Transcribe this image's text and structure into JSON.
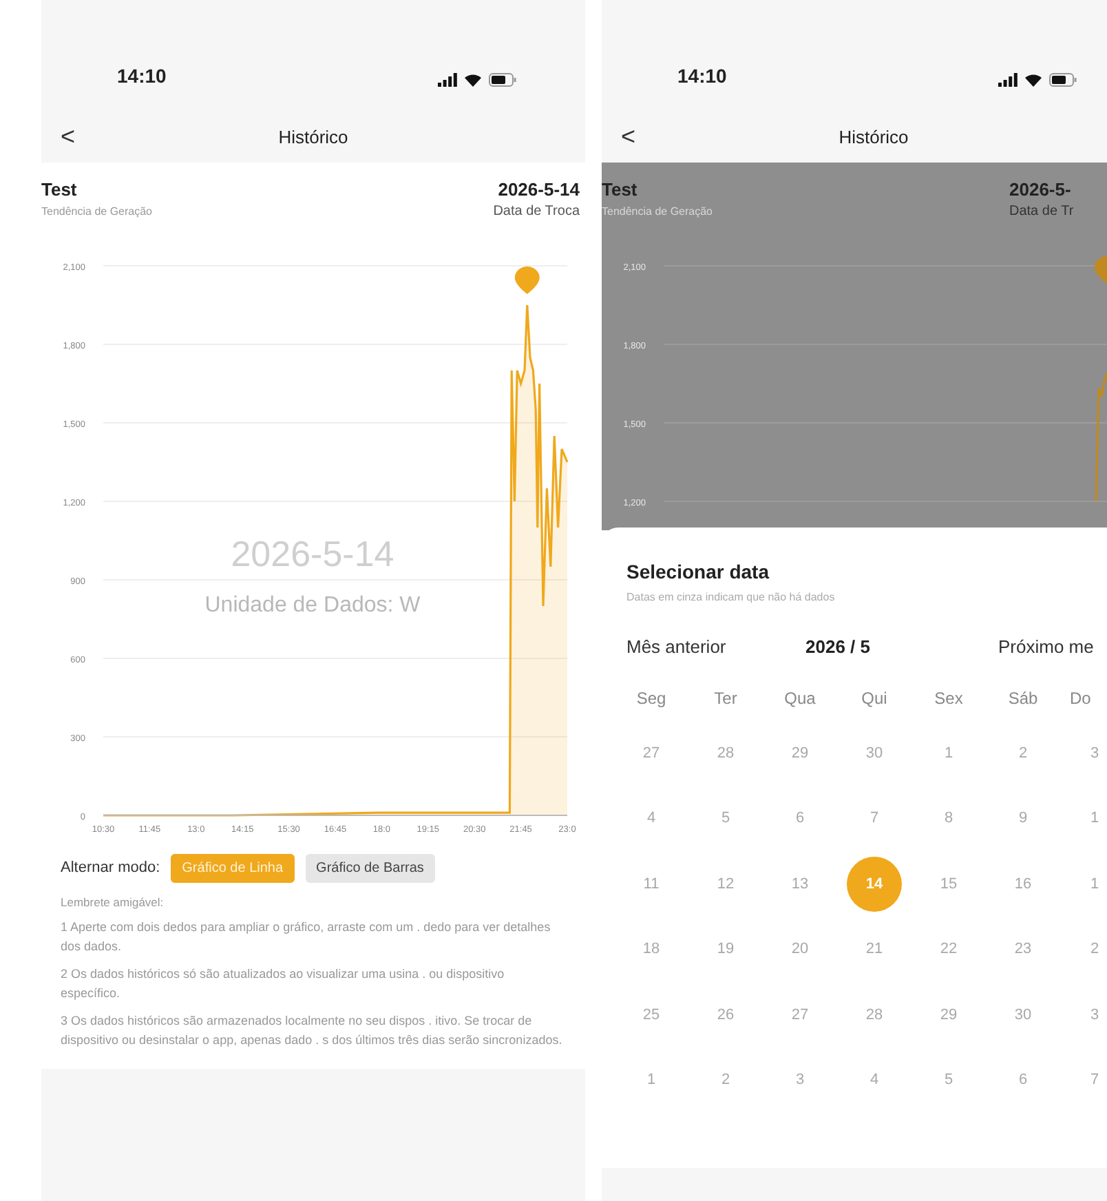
{
  "left_screen": {
    "status_bar": {
      "time": "14:10"
    },
    "nav": {
      "back": "<",
      "title": "Histórico"
    },
    "header": {
      "name": "Test",
      "subtitle": "Tendência de Geração",
      "date": "2026-5-14",
      "date_label": "Data de Troca"
    },
    "chart": {
      "watermark_date": "2026-5-14",
      "watermark_unit": "Unidade de Dados: W",
      "chart_data": {
        "type": "line",
        "x": [
          10.5,
          14.0,
          17.9,
          21.45,
          21.5,
          21.58,
          21.65,
          21.75,
          21.85,
          21.92,
          22.0,
          22.08,
          22.15,
          22.2,
          22.25,
          22.35,
          22.45,
          22.55,
          22.65,
          22.75,
          22.85,
          23.0
        ],
        "series": [
          {
            "color": "#f0a81c",
            "values": [
              0,
              0,
              10,
              10,
              1700,
              1200,
              1700,
              1650,
              1700,
              1950,
              1750,
              1700,
              1550,
              1100,
              1650,
              800,
              1250,
              950,
              1450,
              1100,
              1400,
              1350
            ]
          }
        ],
        "xlim": [
          10.5,
          23.0
        ],
        "ylim": [
          0,
          2100
        ],
        "grid": true,
        "xticks": [
          {
            "value": 10.5,
            "label": "10:30"
          },
          {
            "value": 11.75,
            "label": "11:45"
          },
          {
            "value": 13.0,
            "label": "13:0"
          },
          {
            "value": 14.25,
            "label": "14:15"
          },
          {
            "value": 15.5,
            "label": "15:30"
          },
          {
            "value": 16.75,
            "label": "16:45"
          },
          {
            "value": 18.0,
            "label": "18:0"
          },
          {
            "value": 19.25,
            "label": "19:15"
          },
          {
            "value": 20.5,
            "label": "20:30"
          },
          {
            "value": 21.75,
            "label": "21:45"
          },
          {
            "value": 23.0,
            "label": "23:0"
          }
        ],
        "yticks": [
          {
            "value": 0,
            "label": "0"
          },
          {
            "value": 300,
            "label": "300"
          },
          {
            "value": 600,
            "label": "600"
          },
          {
            "value": 900,
            "label": "900"
          },
          {
            "value": 1200,
            "label": "1,200"
          },
          {
            "value": 1500,
            "label": "1,500"
          },
          {
            "value": 1800,
            "label": "1,800"
          },
          {
            "value": 2100,
            "label": "2,100"
          }
        ]
      }
    },
    "mode": {
      "label": "Alternar modo:",
      "options": [
        {
          "label": "Gráfico de Linha",
          "selected": true
        },
        {
          "label": "Gráfico de Barras",
          "selected": false
        }
      ]
    },
    "tips": {
      "title": "Lembrete amigável:",
      "items": [
        "1 Aperte com dois dedos para ampliar o gráfico, arraste com um . dedo para ver detalhes dos dados.",
        "2 Os dados históricos só são atualizados ao visualizar uma usina . ou dispositivo específico.",
        "3 Os dados históricos são armazenados localmente no seu dispos . itivo. Se trocar de dispositivo ou desinstalar o app, apenas dado . s dos últimos três dias serão sincronizados."
      ]
    }
  },
  "right_screen": {
    "status_bar": {
      "time": "14:10"
    },
    "nav": {
      "back": "<",
      "title": "Histórico"
    },
    "header": {
      "name": "Test",
      "subtitle": "Tendência de Geração",
      "date": "2026-5-",
      "date_label": "Data de Tr"
    },
    "chart": {
      "kind": "picture",
      "y_labels": [
        "2,100",
        "1,800",
        "1,500",
        "1,200"
      ]
    },
    "date_sheet": {
      "title": "Selecionar data",
      "hint": "Datas em cinza indicam que não há dados",
      "prev": "Mês anterior",
      "month": "2026 / 5",
      "next": "Próximo me",
      "weekdays": [
        "Seg",
        "Ter",
        "Qua",
        "Qui",
        "Sex",
        "Sáb",
        "Do"
      ],
      "days": [
        {
          "label": "27",
          "selected": false
        },
        {
          "label": "28",
          "selected": false
        },
        {
          "label": "29",
          "selected": false
        },
        {
          "label": "30",
          "selected": false
        },
        {
          "label": "1",
          "selected": false
        },
        {
          "label": "2",
          "selected": false
        },
        {
          "label": "3",
          "selected": false
        },
        {
          "label": "4",
          "selected": false
        },
        {
          "label": "5",
          "selected": false
        },
        {
          "label": "6",
          "selected": false
        },
        {
          "label": "7",
          "selected": false
        },
        {
          "label": "8",
          "selected": false
        },
        {
          "label": "9",
          "selected": false
        },
        {
          "label": "1",
          "selected": false
        },
        {
          "label": "11",
          "selected": false
        },
        {
          "label": "12",
          "selected": false
        },
        {
          "label": "13",
          "selected": false
        },
        {
          "label": "14",
          "selected": true
        },
        {
          "label": "15",
          "selected": false
        },
        {
          "label": "16",
          "selected": false
        },
        {
          "label": "1",
          "selected": false
        },
        {
          "label": "18",
          "selected": false
        },
        {
          "label": "19",
          "selected": false
        },
        {
          "label": "20",
          "selected": false
        },
        {
          "label": "21",
          "selected": false
        },
        {
          "label": "22",
          "selected": false
        },
        {
          "label": "23",
          "selected": false
        },
        {
          "label": "2",
          "selected": false
        },
        {
          "label": "25",
          "selected": false
        },
        {
          "label": "26",
          "selected": false
        },
        {
          "label": "27",
          "selected": false
        },
        {
          "label": "28",
          "selected": false
        },
        {
          "label": "29",
          "selected": false
        },
        {
          "label": "30",
          "selected": false
        },
        {
          "label": "3",
          "selected": false
        },
        {
          "label": "1",
          "selected": false
        },
        {
          "label": "2",
          "selected": false
        },
        {
          "label": "3",
          "selected": false
        },
        {
          "label": "4",
          "selected": false
        },
        {
          "label": "5",
          "selected": false
        },
        {
          "label": "6",
          "selected": false
        },
        {
          "label": "7",
          "selected": false
        }
      ]
    }
  }
}
